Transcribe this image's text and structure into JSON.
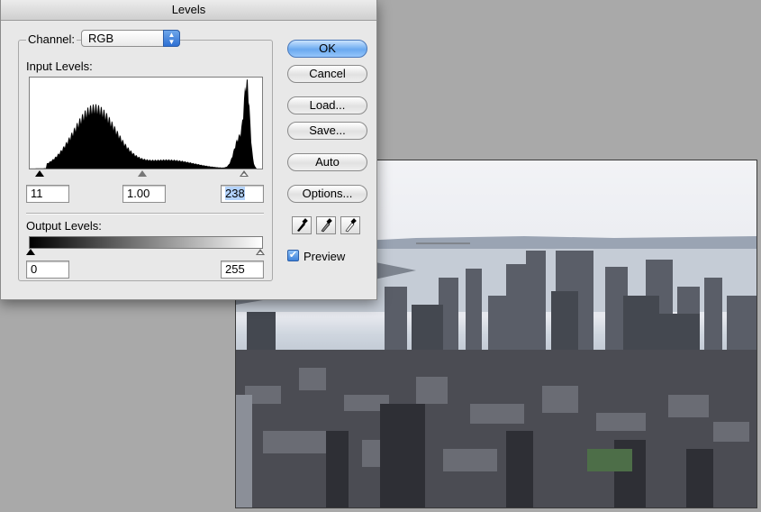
{
  "window": {
    "title": "Levels"
  },
  "channel": {
    "label": "Channel:",
    "value": "RGB",
    "icon": "updown-arrows-icon"
  },
  "input_levels": {
    "label": "Input Levels:",
    "black": "11",
    "gamma": "1.00",
    "white": "238"
  },
  "output_levels": {
    "label": "Output Levels:",
    "black": "0",
    "white": "255"
  },
  "buttons": {
    "ok": "OK",
    "cancel": "Cancel",
    "load": "Load...",
    "save": "Save...",
    "auto": "Auto",
    "options": "Options..."
  },
  "eyedroppers": [
    "black-point-eyedropper-icon",
    "gray-point-eyedropper-icon",
    "white-point-eyedropper-icon"
  ],
  "preview": {
    "label": "Preview",
    "checked": true
  },
  "colors": {
    "accent": "#3e83da",
    "dialog_bg": "#e8e8e8",
    "desktop_bg": "#a9a9a9"
  }
}
